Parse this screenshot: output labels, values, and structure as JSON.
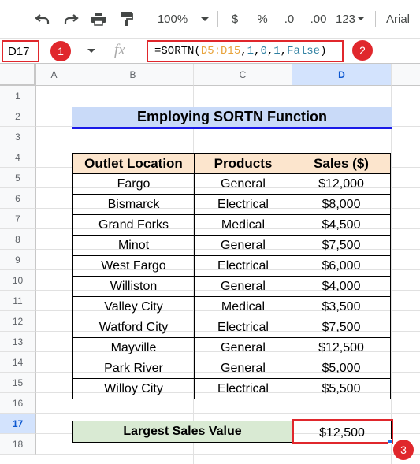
{
  "toolbar": {
    "zoom": "100%",
    "currency": "$",
    "percent": "%",
    "dec_decrease": ".0",
    "dec_increase": ".00",
    "format": "123",
    "font": "Arial"
  },
  "formula_bar": {
    "cell_ref": "D17",
    "fx": "fx",
    "formula_fn": "=SORTN(",
    "formula_ref": "D5:D15",
    "formula_c1": ",",
    "formula_n1": "1",
    "formula_c2": ",",
    "formula_n2": "0",
    "formula_c3": ",",
    "formula_n3": "1",
    "formula_c4": ",",
    "formula_bool": "False",
    "formula_end": ")"
  },
  "badges": [
    "1",
    "2",
    "3"
  ],
  "columns": [
    "A",
    "B",
    "C",
    "D"
  ],
  "rows": [
    "1",
    "2",
    "3",
    "4",
    "5",
    "6",
    "7",
    "8",
    "9",
    "10",
    "11",
    "12",
    "13",
    "14",
    "15",
    "16",
    "17",
    "18"
  ],
  "title": "Employing SORTN Function",
  "table": {
    "headers": [
      "Outlet Location",
      "Products",
      "Sales ($)"
    ],
    "rows": [
      [
        "Fargo",
        "General",
        "$12,000"
      ],
      [
        "Bismarck",
        "Electrical",
        "$8,000"
      ],
      [
        "Grand Forks",
        "Medical",
        "$4,500"
      ],
      [
        "Minot",
        "General",
        "$7,500"
      ],
      [
        "West Fargo",
        "Electrical",
        "$6,000"
      ],
      [
        "Williston",
        "General",
        "$4,000"
      ],
      [
        "Valley City",
        "Medical",
        "$3,500"
      ],
      [
        "Watford City",
        "Electrical",
        "$7,500"
      ],
      [
        "Mayville",
        "General",
        "$12,500"
      ],
      [
        "Park River",
        "General",
        "$5,000"
      ],
      [
        "Willoy City",
        "Electrical",
        "$5,500"
      ]
    ]
  },
  "result": {
    "label": "Largest Sales Value",
    "value": "$12,500"
  },
  "colors": {
    "highlight_red": "#e0272c",
    "title_bg": "#c9daf8",
    "header_bg": "#fce5cd",
    "result_label_bg": "#d9ead3"
  }
}
